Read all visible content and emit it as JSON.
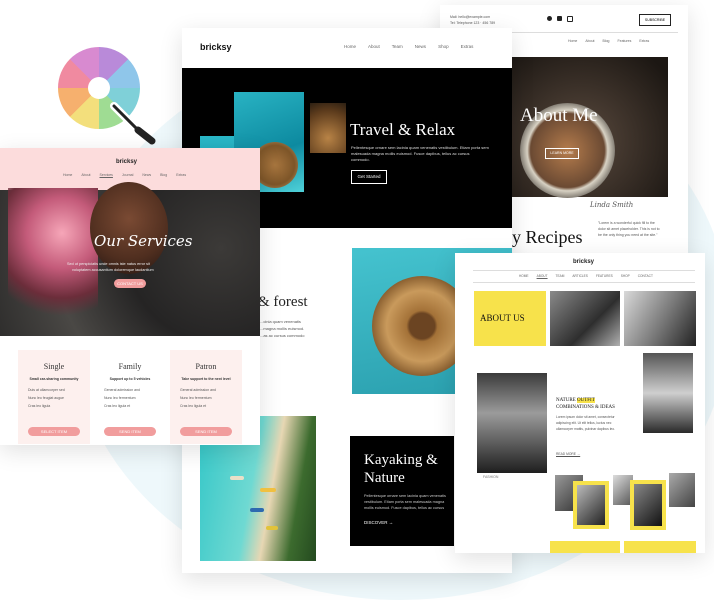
{
  "colors": {
    "pink_header": "#fcdcdc",
    "pink_button": "#f19d9d",
    "yellow": "#f7e24b",
    "black": "#000000",
    "teal": "#2fc6cf"
  },
  "icons": [
    "color-wheel-icon",
    "eyedropper-icon",
    "facebook-icon",
    "twitter-icon",
    "instagram-icon"
  ],
  "travel_site": {
    "logo": "bricksy",
    "nav": [
      "Home",
      "About",
      "Team",
      "News",
      "Shop",
      "Extras"
    ],
    "hero_title": "Travel & Relax",
    "hero_text_1": "Pellentesque ornare sem lacinia quam venenatis vestibulum. Etiam porta sem",
    "hero_text_2": "malesuada magna mollis euismod. Fusce dapibus, tellus ac cursus",
    "hero_text_3": "commodo.",
    "hero_button": "Get Started",
    "forest_title": "& forest",
    "forest_text_1": "...cinia quam venenatis",
    "forest_text_2": "...magna mollis euismod.",
    "forest_text_3": "...as ac cursus commodo",
    "kayak_title_1": "Kayaking &",
    "kayak_title_2": "Nature",
    "kayak_text_1": "Pellentesque ornare sem lacinia quam venenatis",
    "kayak_text_2": "vestibulum. Etiam porta sem malesuada magna",
    "kayak_text_3": "mollis euismod. Fusce dapibus, tellus ac cursus",
    "kayak_link": "DISCOVER →"
  },
  "services_site": {
    "logo": "bricksy",
    "nav": [
      "Home",
      "About",
      "Services",
      "Journal",
      "News",
      "Blog",
      "Extras"
    ],
    "hero_title": "Our Services",
    "hero_text_1": "Sed ut perspiciatis unde omnis iste natus error sit",
    "hero_text_2": "voluptatem accusantium doloremque laudantium",
    "hero_button": "CONTACT US",
    "plans": [
      {
        "name": "Single",
        "sub": "Small car-sharing community",
        "f1": "Duis at ullamcorper sed",
        "f2": "Nunc leo feugiat augue",
        "f3": "Cras leo ligula",
        "button": "SELECT ITEM"
      },
      {
        "name": "Family",
        "sub": "Support up to 5 vehicles",
        "f1": "General admission and",
        "f2": "Nunc leo fermentum",
        "f3": "Cras leo ligula et",
        "button": "SEND ITEM"
      },
      {
        "name": "Patron",
        "sub": "Take support to the next level",
        "f1": "General admission and",
        "f2": "Nunc leo fermentum",
        "f3": "Cras leo ligula et",
        "button": "SEND ITEM"
      }
    ]
  },
  "food_blog": {
    "contact_1": "Mail: hello@example.com",
    "contact_2": "Tel: Telephone 123 · 456 789",
    "subscribe": "SUBSCRIBE",
    "nav": [
      "Home",
      "About",
      "Blog",
      "Features",
      "Extras"
    ],
    "hero_title": "About Me",
    "hero_button": "LEARN MORE",
    "signature": "Linda Smith",
    "recipes_title": "y Recipes",
    "quote_1": "\"Lorem is a wonderful quick fill to the",
    "quote_2": "dolor sit amet placeholder. This is not to",
    "quote_3": "be the only thing you need at the site.\""
  },
  "fashion_site": {
    "logo": "bricksy",
    "nav": [
      "HOME",
      "ABOUT",
      "TEAM",
      "ARTICLES",
      "FEATURES",
      "SHOP",
      "CONTACT"
    ],
    "about_label": "ABOUT US",
    "headline_1a": "NATURE",
    "headline_1b": "OUTFIT",
    "headline_2": "COMBINATIONS & IDEAS",
    "body_1": "Lorem ipsum dolor sit amet, consectetur",
    "body_2": "adipiscing elit. Ut elit tellus, luctus nec",
    "body_3": "ullamcorper mattis, pulvinar dapibus leo.",
    "link": "READ MORE →",
    "side_label": "FASHION"
  }
}
